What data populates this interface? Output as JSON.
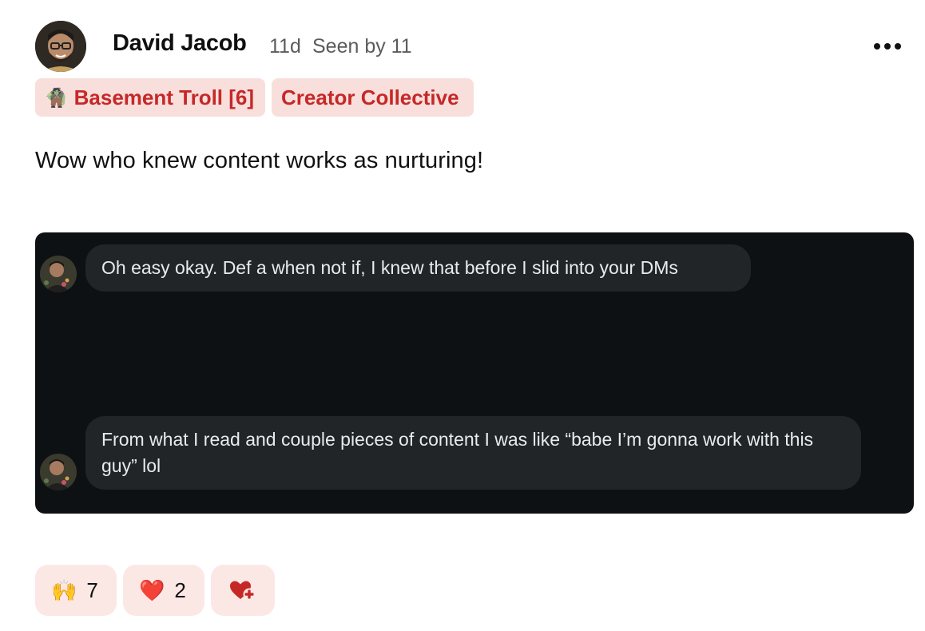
{
  "post": {
    "author": "David Jacob",
    "age": "11d",
    "seen": "Seen by 11",
    "tags": [
      {
        "emoji": "🧌",
        "label": "Basement Troll [6]"
      },
      {
        "label": "Creator Collective"
      }
    ],
    "text": "Wow who knew content works as nurturing!"
  },
  "media": {
    "messages": [
      {
        "text": "Oh easy okay. Def a when not if, I knew that before I slid into your DMs"
      },
      {
        "text": "From what I read and couple pieces of content I was like “babe I’m gonna work with this guy” lol"
      }
    ]
  },
  "reactions": [
    {
      "emoji": "🙌",
      "count": "7"
    },
    {
      "emoji": "❤️",
      "count": "2"
    }
  ],
  "icons": {
    "more": "more-options-icon",
    "add_reaction": "heart-plus-icon"
  },
  "colors": {
    "tag_bg": "#f8dfdc",
    "tag_text": "#c62828",
    "reaction_bg": "#fbe8e5",
    "media_bg": "#0d1114",
    "bubble_bg": "#212527"
  }
}
